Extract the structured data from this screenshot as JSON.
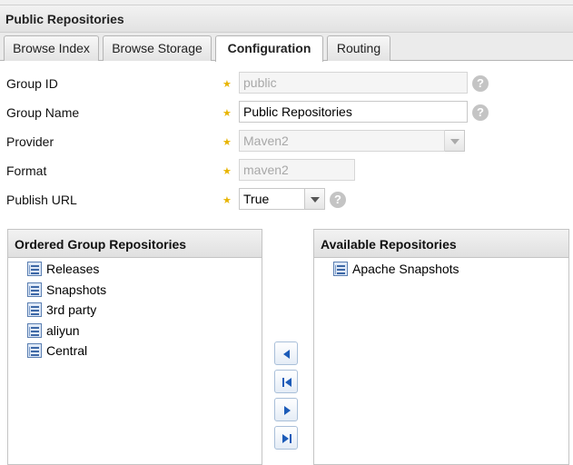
{
  "panel": {
    "title": "Public Repositories"
  },
  "tabs": [
    {
      "label": "Browse Index",
      "active": false
    },
    {
      "label": "Browse Storage",
      "active": false
    },
    {
      "label": "Configuration",
      "active": true
    },
    {
      "label": "Routing",
      "active": false
    }
  ],
  "form": {
    "group_id": {
      "label": "Group ID",
      "value": "public",
      "disabled": true
    },
    "group_name": {
      "label": "Group Name",
      "value": "Public Repositories",
      "disabled": false
    },
    "provider": {
      "label": "Provider",
      "value": "Maven2",
      "disabled": true
    },
    "format": {
      "label": "Format",
      "value": "maven2",
      "disabled": true
    },
    "publish_url": {
      "label": "Publish URL",
      "value": "True",
      "disabled": false
    },
    "help_symbol": "?",
    "required_symbol": "★"
  },
  "ordered": {
    "header": "Ordered Group Repositories",
    "items": [
      "Releases",
      "Snapshots",
      "3rd party",
      "aliyun",
      "Central"
    ]
  },
  "available": {
    "header": "Available Repositories",
    "items": [
      "Apache Snapshots"
    ]
  },
  "colors": {
    "accent": "#1c5bb8",
    "required_star": "#e8b400"
  }
}
